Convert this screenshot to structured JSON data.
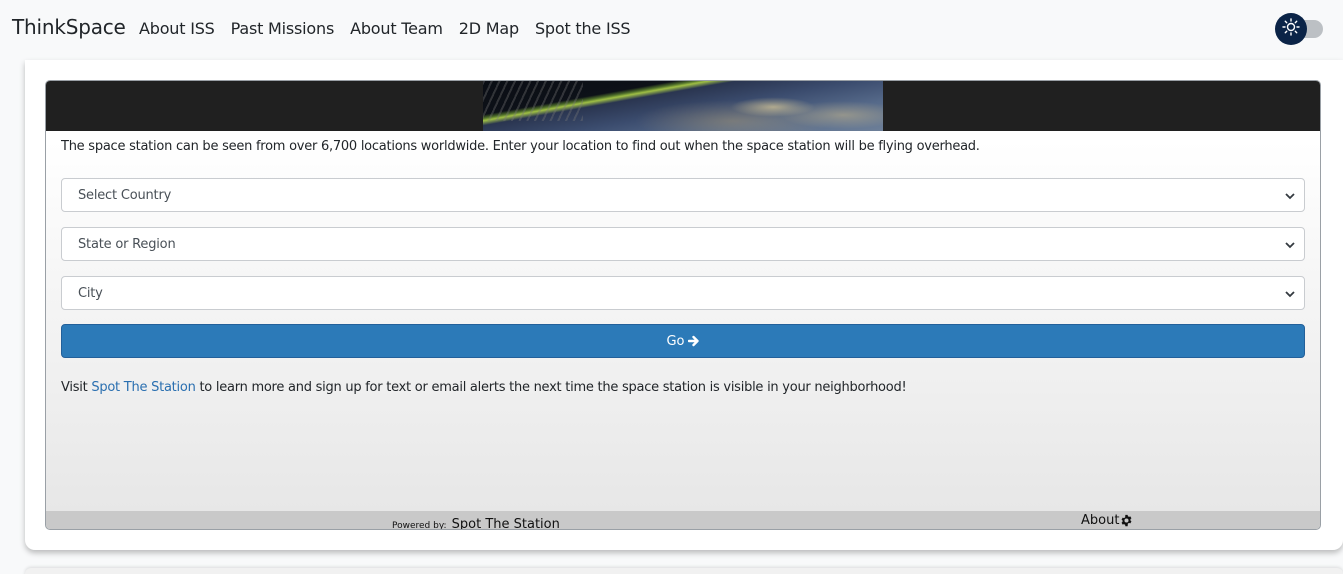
{
  "navbar": {
    "brand": "ThinkSpace",
    "links": [
      "About ISS",
      "Past Missions",
      "About Team",
      "2D Map",
      "Spot the ISS"
    ],
    "theme_toggle_icon": "sun-icon"
  },
  "widget": {
    "intro_text": "The space station can be seen from over 6,700 locations worldwide. Enter your location to find out when the space station will be flying overhead.",
    "selects": {
      "country": "Select Country",
      "region": "State or Region",
      "city": "City"
    },
    "go_label": "Go",
    "visit_prefix": "Visit ",
    "visit_link": "Spot The Station",
    "visit_suffix": " to learn more and sign up for text or email alerts the next time the space station is visible in your neighborhood!",
    "footer": {
      "powered_by": "Powered by:",
      "powered_name": "Spot The Station",
      "about_label": "About"
    }
  },
  "colors": {
    "nav_bg": "#f8f9fa",
    "toggle_knob": "#0b2447",
    "go_button": "#2c7ab8",
    "link": "#2a6fb0",
    "footer_bg": "#c9c9c9"
  }
}
